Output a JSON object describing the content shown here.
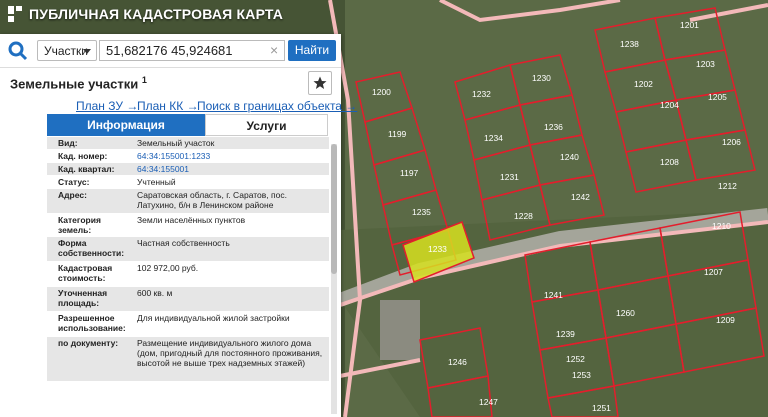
{
  "app": {
    "title": "ПУБЛИЧНАЯ КАДАСТРОВАЯ КАРТА"
  },
  "search": {
    "type_label": "Участки",
    "query": "51,682176 45,924681",
    "clear_glyph": "×",
    "button_label": "Найти"
  },
  "card": {
    "heading": "Земельные участки",
    "heading_count": "1",
    "links": [
      "План ЗУ →",
      "План КК →",
      "Поиск в границах объекта →"
    ],
    "tabs": [
      "Информация",
      "Услуги"
    ],
    "rows": [
      {
        "key": "Вид:",
        "value": "Земельный участок",
        "link": false
      },
      {
        "key": "Кад. номер:",
        "value": "64:34:155001:1233",
        "link": true
      },
      {
        "key": "Кад. квартал:",
        "value": "64:34:155001",
        "link": true
      },
      {
        "key": "Статус:",
        "value": "Учтенный",
        "link": false
      },
      {
        "key": "Адрес:",
        "value": "Саратовская область, г. Саратов, пос. Латухино, б/н в Ленинском районе",
        "link": false
      },
      {
        "key": "Категория земель:",
        "value": "Земли населённых пунктов",
        "link": false
      },
      {
        "key": "Форма собственности:",
        "value": "Частная собственность",
        "link": false
      },
      {
        "key": "Кадастровая стоимость:",
        "value": "102 972,00 руб.",
        "link": false
      },
      {
        "key": "Уточненная площадь:",
        "value": "600 кв. м",
        "link": false
      },
      {
        "key": "Разрешенное использование:",
        "value": "Для индивидуальной жилой застройки",
        "link": false
      },
      {
        "key": "по документу:",
        "value": "Размещение индивидуального жилого дома (дом, пригодный для постоянного проживания, высотой не выше трех надземных этажей)",
        "link": false
      }
    ]
  },
  "map": {
    "parcel_labels": [
      "1200",
      "1199",
      "1197",
      "1235",
      "1233",
      "1232",
      "1234",
      "1231",
      "1228",
      "1230",
      "1236",
      "1240",
      "1242",
      "1238",
      "1202",
      "1204",
      "1208",
      "1201",
      "1203",
      "1205",
      "1206",
      "1207",
      "1210",
      "1241",
      "1260",
      "1209",
      "1239",
      "1252",
      "1253",
      "1246",
      "1247",
      "1251",
      "1212"
    ],
    "colors": {
      "boundary": "#e31e2c",
      "highlight": "#d7e020",
      "road": "#f3b9b9",
      "accent": "#1f6fc1"
    }
  }
}
